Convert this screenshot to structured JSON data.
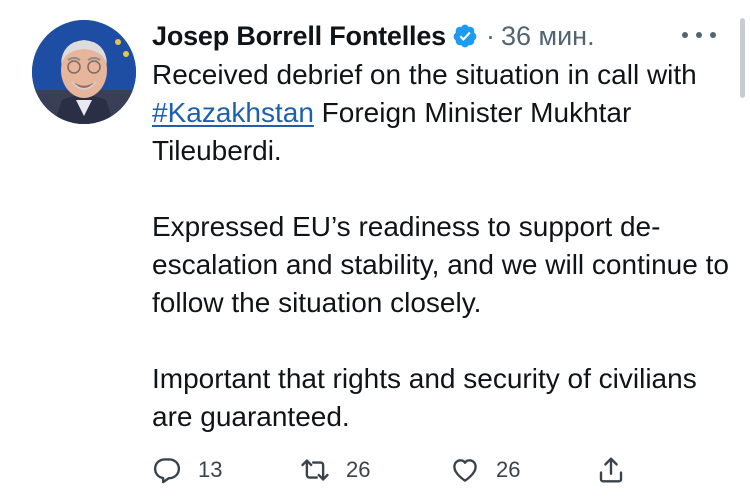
{
  "tweet": {
    "author_name": "Josep Borrell Fontelles",
    "separator": "·",
    "time": "36 мин.",
    "text": {
      "line1_pre": "Received debrief on the situation in call with ",
      "hashtag": "#Kazakhstan",
      "line1_post": " Foreign Minister Mukhtar Tileuberdi.",
      "para2": "Expressed EU’s readiness to support de-escalation and stability, and we will continue to follow the situation closely.",
      "para3": "Important that rights and security of civilians are guaranteed."
    },
    "stats": {
      "replies": "13",
      "retweets": "26",
      "likes": "26"
    }
  },
  "icons": {
    "verified": "verified-badge-icon",
    "more": "more-options-icon",
    "reply": "reply-icon",
    "retweet": "retweet-icon",
    "like": "heart-icon",
    "share": "share-icon"
  },
  "colors": {
    "text": "#0f1419",
    "secondary": "#536471",
    "link": "#1d5fb0",
    "verified": "#1d9bf0"
  }
}
